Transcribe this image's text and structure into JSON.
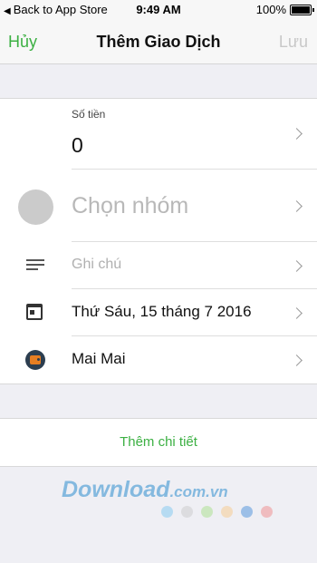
{
  "status_bar": {
    "back_label": "Back to App Store",
    "time": "9:49 AM",
    "battery": "100%"
  },
  "nav": {
    "cancel": "Hủy",
    "title": "Thêm Giao Dịch",
    "save": "Lưu"
  },
  "form": {
    "amount_label": "Số tiền",
    "amount_value": "0",
    "group_placeholder": "Chọn nhóm",
    "note_placeholder": "Ghi chú",
    "date": "Thứ Sáu, 15 tháng 7 2016",
    "wallet": "Mai Mai"
  },
  "more_details": "Thêm chi tiết",
  "watermark": {
    "text": "Download",
    "domain": ".com.vn",
    "dot_colors": [
      "#7ec8f0",
      "#c9c9c9",
      "#a8e08a",
      "#f7c98a",
      "#4a90d9",
      "#f08a8a"
    ]
  },
  "colors": {
    "accent": "#3cb043",
    "disabled": "#c8c8c8",
    "background": "#efeff4"
  },
  "icons": [
    "chevron-right-icon",
    "note-lines-icon",
    "calendar-icon",
    "wallet-icon",
    "battery-icon"
  ]
}
